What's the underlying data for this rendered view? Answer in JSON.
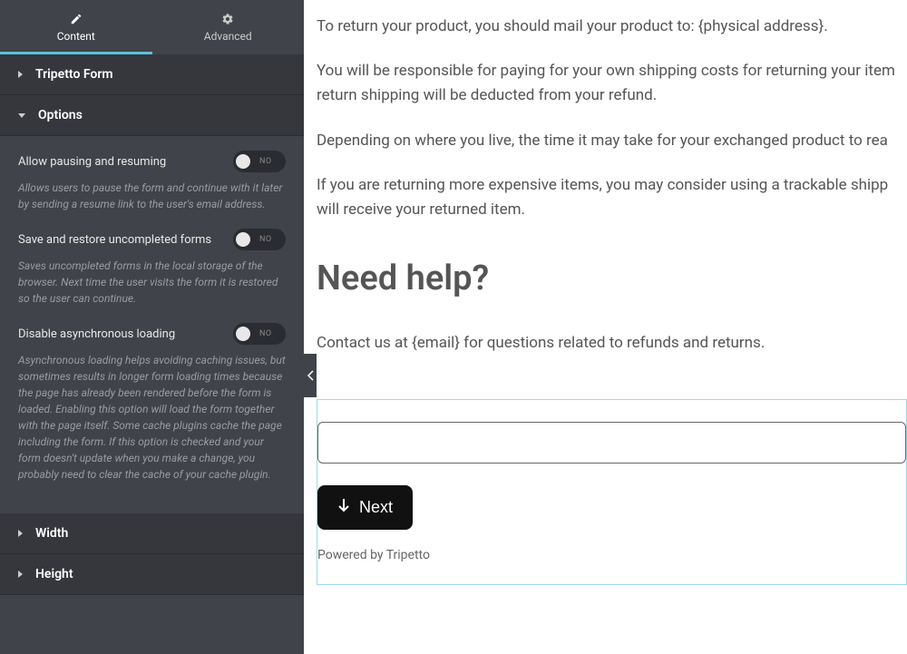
{
  "tabs": {
    "content": "Content",
    "advanced": "Advanced"
  },
  "sections": {
    "tripettoForm": "Tripetto Form",
    "options": "Options",
    "width": "Width",
    "height": "Height"
  },
  "options": {
    "pausing": {
      "label": "Allow pausing and resuming",
      "desc": "Allows users to pause the form and continue with it later by sending a resume link to the user's email address.",
      "stateLabel": "NO"
    },
    "saveRestore": {
      "label": "Save and restore uncompleted forms",
      "desc": "Saves uncompleted forms in the local storage of the browser. Next time the user visits the form it is restored so the user can continue.",
      "stateLabel": "NO"
    },
    "disableAsync": {
      "label": "Disable asynchronous loading",
      "desc": "Asynchronous loading helps avoiding caching issues, but sometimes results in longer form loading times because the page has already been rendered before the form is loaded. Enabling this option will load the form together with the page itself. Some cache plugins cache the page including the form. If this option is checked and your form doesn't update when you make a change, you probably need to clear the cache of your cache plugin.",
      "stateLabel": "NO"
    }
  },
  "page": {
    "p1": "To return your product, you should mail your product to: {physical address}.",
    "p2": "You will be responsible for paying for your own shipping costs for returning your item return shipping will be deducted from your refund.",
    "p3": "Depending on where you live, the time it may take for your exchanged product to rea",
    "p4": "If you are returning more expensive items, you may consider using a trackable shipp will receive your returned item.",
    "heading": "Need help?",
    "p5": "Contact us at {email} for questions related to refunds and returns.",
    "nextLabel": "Next",
    "powered": "Powered by Tripetto"
  }
}
